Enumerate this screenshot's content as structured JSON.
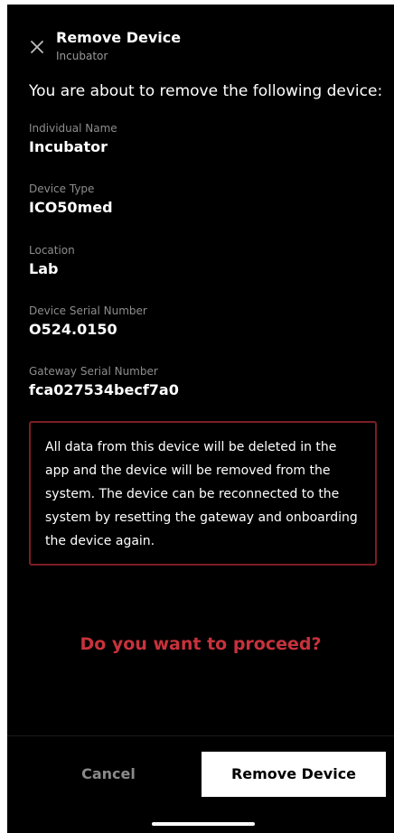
{
  "header": {
    "title": "Remove Device",
    "subtitle": "Incubator",
    "close_icon": "close-icon"
  },
  "intro": "You are about to remove the following device:",
  "fields": [
    {
      "label": "Individual Name",
      "value": "Incubator"
    },
    {
      "label": "Device Type",
      "value": "ICO50med"
    },
    {
      "label": "Location",
      "value": "Lab"
    },
    {
      "label": "Device Serial Number",
      "value": "O524.0150"
    },
    {
      "label": "Gateway Serial Number",
      "value": "fca027534becf7a0"
    }
  ],
  "warning": {
    "text": "All data from this device will be deleted in the app and the device will be removed from the system. The device can be reconnected to the system by resetting the gateway and onboarding the device again.",
    "border_color": "#7c1d24"
  },
  "question": {
    "text": "Do you want to proceed?",
    "color": "#c8323c"
  },
  "actions": {
    "cancel_label": "Cancel",
    "remove_label": "Remove Device"
  },
  "colors": {
    "background": "#000000",
    "primary_button": "#ffffff"
  }
}
